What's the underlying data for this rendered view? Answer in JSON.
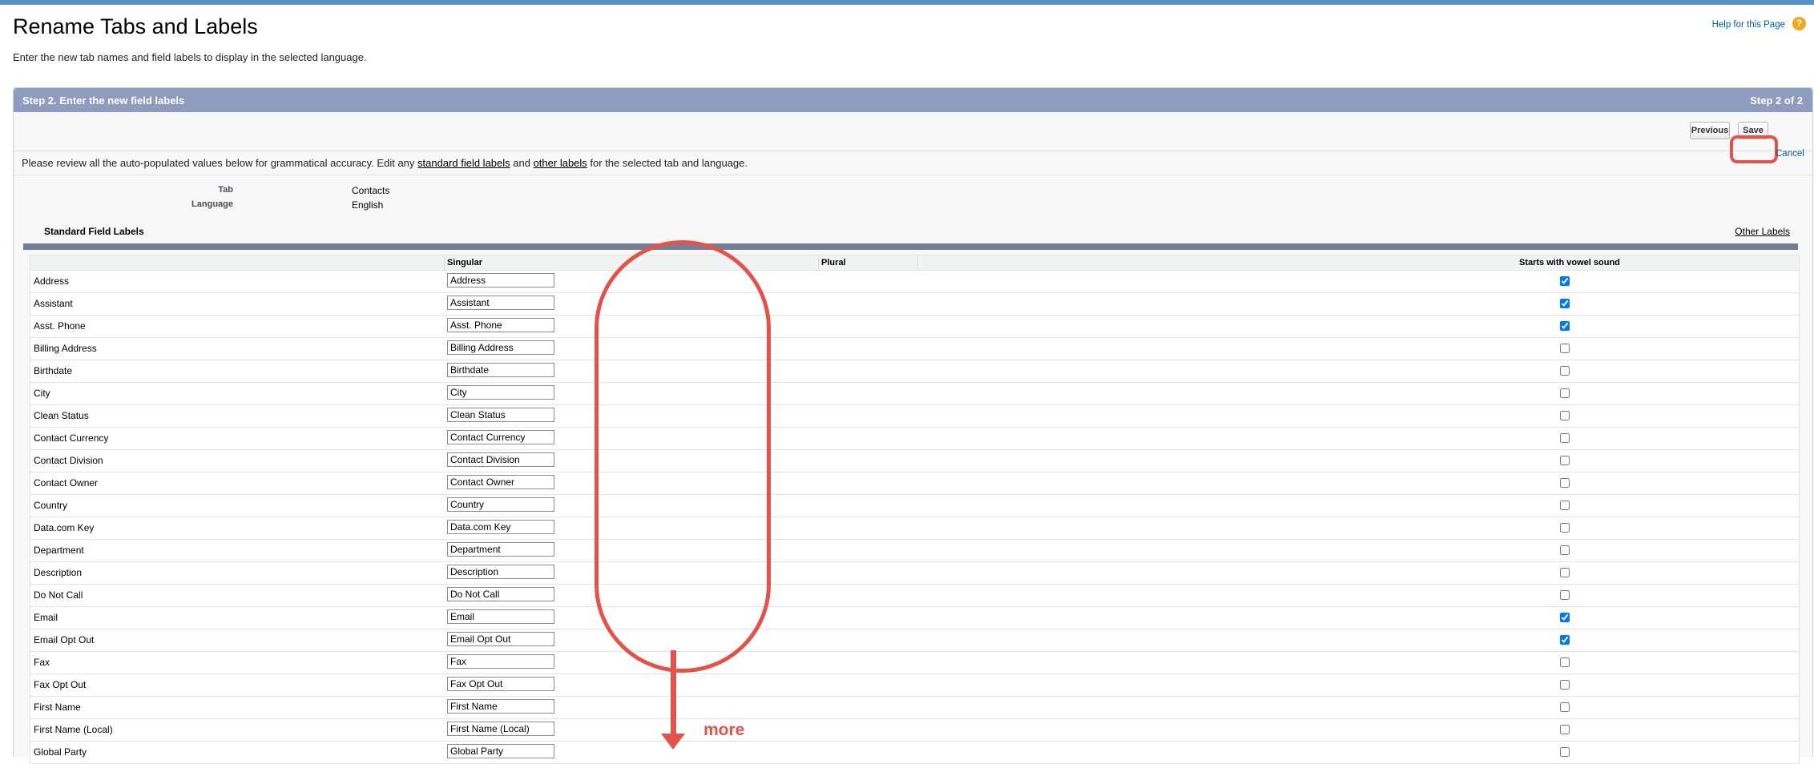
{
  "page": {
    "title": "Rename Tabs and Labels",
    "description": "Enter the new tab names and field labels to display in the selected language.",
    "help_link": "Help for this Page",
    "help_icon": "?"
  },
  "step": {
    "title": "Step 2. Enter the new field labels",
    "indicator": "Step 2 of 2"
  },
  "buttons": {
    "previous": "Previous",
    "save": "Save",
    "cancel": "Cancel"
  },
  "instructions": {
    "part1": "Please review all the auto-populated values below for grammatical accuracy. Edit any ",
    "link1": "standard field labels",
    "part2": " and ",
    "link2": "other labels",
    "part3": " for the selected tab and language."
  },
  "meta": {
    "tab_label": "Tab",
    "tab_value": "Contacts",
    "language_label": "Language",
    "language_value": "English"
  },
  "section": {
    "title": "Standard Field Labels",
    "other_labels": "Other Labels"
  },
  "columns": {
    "singular": "Singular",
    "plural": "Plural",
    "vowel": "Starts with vowel sound"
  },
  "rows": [
    {
      "label": "Address",
      "singular": "Address",
      "vowel": true
    },
    {
      "label": "Assistant",
      "singular": "Assistant",
      "vowel": true
    },
    {
      "label": "Asst. Phone",
      "singular": "Asst. Phone",
      "vowel": true
    },
    {
      "label": "Billing Address",
      "singular": "Billing Address",
      "vowel": false
    },
    {
      "label": "Birthdate",
      "singular": "Birthdate",
      "vowel": false
    },
    {
      "label": "City",
      "singular": "City",
      "vowel": false
    },
    {
      "label": "Clean Status",
      "singular": "Clean Status",
      "vowel": false
    },
    {
      "label": "Contact Currency",
      "singular": "Contact Currency",
      "vowel": false
    },
    {
      "label": "Contact Division",
      "singular": "Contact Division",
      "vowel": false
    },
    {
      "label": "Contact Owner",
      "singular": "Contact Owner",
      "vowel": false
    },
    {
      "label": "Country",
      "singular": "Country",
      "vowel": false
    },
    {
      "label": "Data.com Key",
      "singular": "Data.com Key",
      "vowel": false
    },
    {
      "label": "Department",
      "singular": "Department",
      "vowel": false
    },
    {
      "label": "Description",
      "singular": "Description",
      "vowel": false
    },
    {
      "label": "Do Not Call",
      "singular": "Do Not Call",
      "vowel": false
    },
    {
      "label": "Email",
      "singular": "Email",
      "vowel": true
    },
    {
      "label": "Email Opt Out",
      "singular": "Email Opt Out",
      "vowel": true
    },
    {
      "label": "Fax",
      "singular": "Fax",
      "vowel": false
    },
    {
      "label": "Fax Opt Out",
      "singular": "Fax Opt Out",
      "vowel": false
    },
    {
      "label": "First Name",
      "singular": "First Name",
      "vowel": false
    },
    {
      "label": "First Name (Local)",
      "singular": "First Name (Local)",
      "vowel": false
    },
    {
      "label": "Global Party",
      "singular": "Global Party",
      "vowel": false
    }
  ],
  "annotation": {
    "more": "more",
    "color": "#e2534b"
  },
  "colors": {
    "header": "#8e9dbd",
    "link": "#015ba7",
    "bar": "#747e96"
  }
}
